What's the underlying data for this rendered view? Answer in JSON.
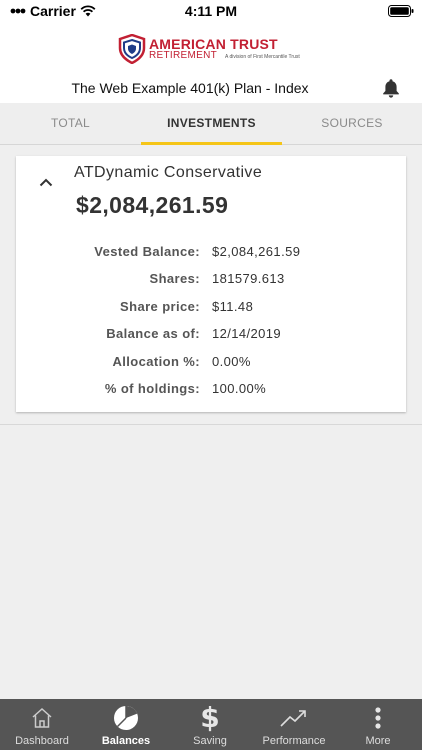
{
  "status_bar": {
    "carrier": "Carrier",
    "time": "4:11 PM"
  },
  "header": {
    "logo_main": "AMERICAN TRUST",
    "logo_sub": "RETIREMENT",
    "logo_division": "A division of First Mercantile Trust",
    "page_title": "The Web Example 401(k) Plan - Index"
  },
  "tabs": [
    {
      "label": "TOTAL",
      "active": false
    },
    {
      "label": "INVESTMENTS",
      "active": true
    },
    {
      "label": "SOURCES",
      "active": false
    }
  ],
  "fund": {
    "name": "ATDynamic Conservative",
    "balance": "$2,084,261.59",
    "details": [
      {
        "label": "Vested Balance:",
        "value": "$2,084,261.59"
      },
      {
        "label": "Shares:",
        "value": "181579.613"
      },
      {
        "label": "Share price:",
        "value": "$11.48"
      },
      {
        "label": "Balance as of:",
        "value": "12/14/2019"
      },
      {
        "label": "Allocation %:",
        "value": "0.00%"
      },
      {
        "label": "% of holdings:",
        "value": "100.00%"
      }
    ]
  },
  "bottom_nav": [
    {
      "label": "Dashboard",
      "icon": "home-icon",
      "active": false
    },
    {
      "label": "Balances",
      "icon": "pie-chart-icon",
      "active": true
    },
    {
      "label": "Saving",
      "icon": "dollar-icon",
      "active": false
    },
    {
      "label": "Performance",
      "icon": "trend-line-icon",
      "active": false
    },
    {
      "label": "More",
      "icon": "more-vertical-icon",
      "active": false
    }
  ],
  "colors": {
    "brand_red": "#c22033",
    "tab_indicator": "#f5c518",
    "nav_bg": "#555555"
  }
}
